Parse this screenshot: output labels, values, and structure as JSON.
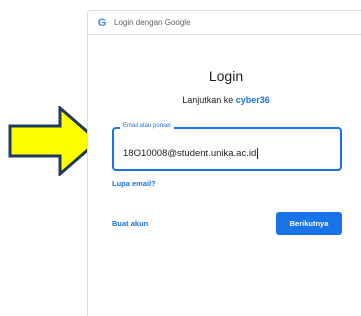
{
  "header": {
    "title": "Login dengan Google"
  },
  "main": {
    "title": "Login",
    "subtitle_prefix": "Lanjutkan ke ",
    "app_name": "cyber36",
    "email_field": {
      "label": "Email atau ponsel",
      "value": "18O10008@student.unika.ac.id"
    },
    "forgot_email": "Lupa email?",
    "create_account": "Buat akun",
    "next_button": "Berikutnya"
  },
  "colors": {
    "accent": "#1a73e8",
    "arrow_fill": "#ffff00",
    "arrow_stroke": "#1f3a5f"
  }
}
